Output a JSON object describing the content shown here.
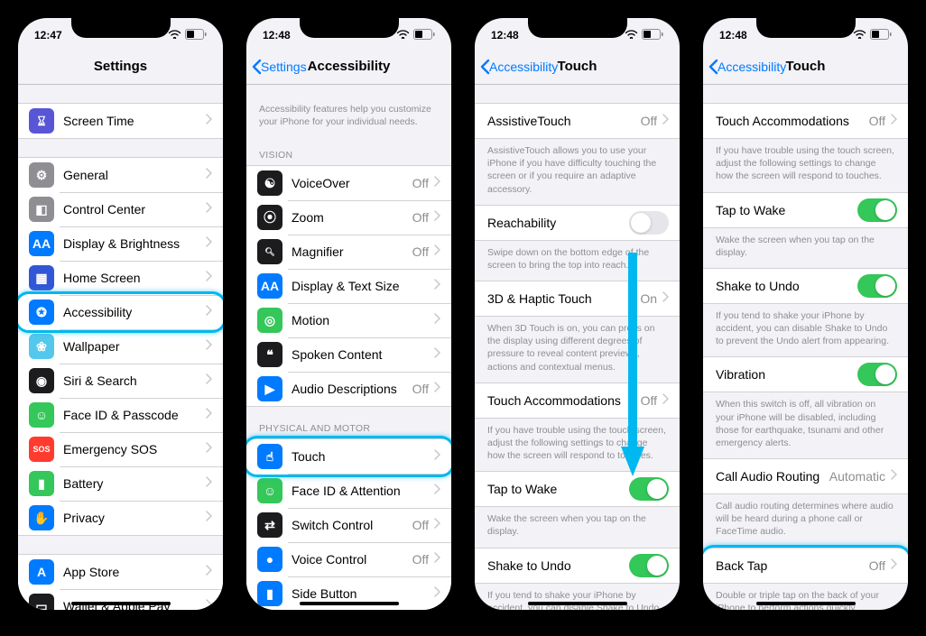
{
  "screens": [
    {
      "time": "12:47",
      "title": "Settings",
      "back": null,
      "intro": null,
      "groups": [
        {
          "header": null,
          "footer": null,
          "rows": [
            {
              "icon": "screen-time-icon",
              "bg": "#5856d6",
              "glyph": "⌛︎",
              "label": "Screen Time",
              "value": null,
              "type": "chev"
            }
          ]
        },
        {
          "header": null,
          "footer": null,
          "rows": [
            {
              "icon": "general-icon",
              "bg": "#8e8e93",
              "glyph": "⚙︎",
              "label": "General",
              "value": null,
              "type": "chev"
            },
            {
              "icon": "control-center-icon",
              "bg": "#8e8e93",
              "glyph": "◧",
              "label": "Control Center",
              "value": null,
              "type": "chev"
            },
            {
              "icon": "display-icon",
              "bg": "#007aff",
              "glyph": "AA",
              "label": "Display & Brightness",
              "value": null,
              "type": "chev"
            },
            {
              "icon": "home-screen-icon",
              "bg": "#3157d6",
              "glyph": "▦",
              "label": "Home Screen",
              "value": null,
              "type": "chev"
            },
            {
              "icon": "accessibility-icon",
              "bg": "#007aff",
              "glyph": "✪",
              "label": "Accessibility",
              "value": null,
              "type": "chev",
              "highlight": true
            },
            {
              "icon": "wallpaper-icon",
              "bg": "#54c7ec",
              "glyph": "❀",
              "label": "Wallpaper",
              "value": null,
              "type": "chev"
            },
            {
              "icon": "siri-icon",
              "bg": "#1c1c1e",
              "glyph": "◉",
              "label": "Siri & Search",
              "value": null,
              "type": "chev"
            },
            {
              "icon": "faceid-icon",
              "bg": "#34c759",
              "glyph": "☺︎",
              "label": "Face ID & Passcode",
              "value": null,
              "type": "chev"
            },
            {
              "icon": "sos-icon",
              "bg": "#ff3b30",
              "glyph": "SOS",
              "label": "Emergency SOS",
              "value": null,
              "type": "chev"
            },
            {
              "icon": "battery-icon",
              "bg": "#34c759",
              "glyph": "▮",
              "label": "Battery",
              "value": null,
              "type": "chev"
            },
            {
              "icon": "privacy-icon",
              "bg": "#007aff",
              "glyph": "✋",
              "label": "Privacy",
              "value": null,
              "type": "chev"
            }
          ]
        },
        {
          "header": null,
          "footer": null,
          "rows": [
            {
              "icon": "appstore-icon",
              "bg": "#007aff",
              "glyph": "A",
              "label": "App Store",
              "value": null,
              "type": "chev"
            },
            {
              "icon": "wallet-icon",
              "bg": "#1c1c1e",
              "glyph": "▭",
              "label": "Wallet & Apple Pay",
              "value": null,
              "type": "chev"
            }
          ]
        }
      ]
    },
    {
      "time": "12:48",
      "title": "Accessibility",
      "back": "Settings",
      "intro": "Accessibility features help you customize your iPhone for your individual needs.",
      "groups": [
        {
          "header": "VISION",
          "footer": null,
          "rows": [
            {
              "icon": "voiceover-icon",
              "bg": "#1c1c1e",
              "glyph": "☯︎",
              "label": "VoiceOver",
              "value": "Off",
              "type": "chev"
            },
            {
              "icon": "zoom-icon",
              "bg": "#1c1c1e",
              "glyph": "⦿",
              "label": "Zoom",
              "value": "Off",
              "type": "chev"
            },
            {
              "icon": "magnifier-icon",
              "bg": "#1c1c1e",
              "glyph": "🔍︎",
              "label": "Magnifier",
              "value": "Off",
              "type": "chev"
            },
            {
              "icon": "textsize-icon",
              "bg": "#007aff",
              "glyph": "AA",
              "label": "Display & Text Size",
              "value": null,
              "type": "chev"
            },
            {
              "icon": "motion-icon",
              "bg": "#34c759",
              "glyph": "◎",
              "label": "Motion",
              "value": null,
              "type": "chev"
            },
            {
              "icon": "spoken-icon",
              "bg": "#1c1c1e",
              "glyph": "❝",
              "label": "Spoken Content",
              "value": null,
              "type": "chev"
            },
            {
              "icon": "audiodesc-icon",
              "bg": "#007aff",
              "glyph": "▶",
              "label": "Audio Descriptions",
              "value": "Off",
              "type": "chev"
            }
          ]
        },
        {
          "header": "PHYSICAL AND MOTOR",
          "footer": null,
          "rows": [
            {
              "icon": "touch-icon",
              "bg": "#007aff",
              "glyph": "☝︎",
              "label": "Touch",
              "value": null,
              "type": "chev",
              "highlight": true
            },
            {
              "icon": "faceid-attention-icon",
              "bg": "#34c759",
              "glyph": "☺︎",
              "label": "Face ID & Attention",
              "value": null,
              "type": "chev"
            },
            {
              "icon": "switch-control-icon",
              "bg": "#1c1c1e",
              "glyph": "⇄",
              "label": "Switch Control",
              "value": "Off",
              "type": "chev"
            },
            {
              "icon": "voice-control-icon",
              "bg": "#007aff",
              "glyph": "●",
              "label": "Voice Control",
              "value": "Off",
              "type": "chev"
            },
            {
              "icon": "side-button-icon",
              "bg": "#007aff",
              "glyph": "▮",
              "label": "Side Button",
              "value": null,
              "type": "chev"
            }
          ]
        }
      ]
    },
    {
      "time": "12:48",
      "title": "Touch",
      "back": "Accessibility",
      "intro": null,
      "arrow": true,
      "groups": [
        {
          "header": null,
          "footer": "AssistiveTouch allows you to use your iPhone if you have difficulty touching the screen or if you require an adaptive accessory.",
          "rows": [
            {
              "icon": null,
              "label": "AssistiveTouch",
              "value": "Off",
              "type": "chev"
            }
          ]
        },
        {
          "header": null,
          "footer": "Swipe down on the bottom edge of the screen to bring the top into reach.",
          "rows": [
            {
              "icon": null,
              "label": "Reachability",
              "value": null,
              "type": "toggle",
              "on": false
            }
          ]
        },
        {
          "header": null,
          "footer": "When 3D Touch is on, you can press on the display using different degrees of pressure to reveal content previews, actions and contextual menus.",
          "rows": [
            {
              "icon": null,
              "label": "3D & Haptic Touch",
              "value": "On",
              "type": "chev"
            }
          ]
        },
        {
          "header": null,
          "footer": "If you have trouble using the touch screen, adjust the following settings to change how the screen will respond to touches.",
          "rows": [
            {
              "icon": null,
              "label": "Touch Accommodations",
              "value": "Off",
              "type": "chev"
            }
          ]
        },
        {
          "header": null,
          "footer": "Wake the screen when you tap on the display.",
          "rows": [
            {
              "icon": null,
              "label": "Tap to Wake",
              "value": null,
              "type": "toggle",
              "on": true
            }
          ]
        },
        {
          "header": null,
          "footer": "If you tend to shake your iPhone by accident, you can disable Shake to Undo to prevent the Undo alert from appearing.",
          "rows": [
            {
              "icon": null,
              "label": "Shake to Undo",
              "value": null,
              "type": "toggle",
              "on": true
            }
          ]
        }
      ]
    },
    {
      "time": "12:48",
      "title": "Touch",
      "back": "Accessibility",
      "intro": null,
      "groups": [
        {
          "header": null,
          "footer": "If you have trouble using the touch screen, adjust the following settings to change how the screen will respond to touches.",
          "rows": [
            {
              "icon": null,
              "label": "Touch Accommodations",
              "value": "Off",
              "type": "chev"
            }
          ]
        },
        {
          "header": null,
          "footer": "Wake the screen when you tap on the display.",
          "rows": [
            {
              "icon": null,
              "label": "Tap to Wake",
              "value": null,
              "type": "toggle",
              "on": true
            }
          ]
        },
        {
          "header": null,
          "footer": "If you tend to shake your iPhone by accident, you can disable Shake to Undo to prevent the Undo alert from appearing.",
          "rows": [
            {
              "icon": null,
              "label": "Shake to Undo",
              "value": null,
              "type": "toggle",
              "on": true
            }
          ]
        },
        {
          "header": null,
          "footer": "When this switch is off, all vibration on your iPhone will be disabled, including those for earthquake, tsunami and other emergency alerts.",
          "rows": [
            {
              "icon": null,
              "label": "Vibration",
              "value": null,
              "type": "toggle",
              "on": true
            }
          ]
        },
        {
          "header": null,
          "footer": "Call audio routing determines where audio will be heard during a phone call or FaceTime audio.",
          "rows": [
            {
              "icon": null,
              "label": "Call Audio Routing",
              "value": "Automatic",
              "type": "chev"
            }
          ]
        },
        {
          "header": null,
          "footer": "Double or triple tap on the back of your iPhone to perform actions quickly.",
          "rows": [
            {
              "icon": null,
              "label": "Back Tap",
              "value": "Off",
              "type": "chev",
              "highlight": true,
              "highlightFooter": true
            }
          ]
        }
      ]
    }
  ]
}
